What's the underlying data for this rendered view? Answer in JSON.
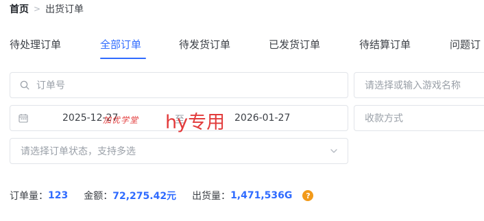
{
  "breadcrumb": {
    "home": "首页",
    "separator": ">",
    "current": "出货订单"
  },
  "tabs": [
    {
      "label": "待处理订单",
      "active": false
    },
    {
      "label": "全部订单",
      "active": true
    },
    {
      "label": "待发货订单",
      "active": false
    },
    {
      "label": "已发货订单",
      "active": false
    },
    {
      "label": "待结算订单",
      "active": false
    },
    {
      "label": "问题订",
      "active": false
    }
  ],
  "filters": {
    "order_no_placeholder": "订单号",
    "game_placeholder": "请选择或输入游戏名称",
    "date_start": "2025-12-27",
    "date_separator": "至",
    "date_end": "2026-01-27",
    "payment_placeholder": "收款方式",
    "status_placeholder": "请选择订单状态，支持多选",
    "watermark_overlay": "hy专用",
    "stamp_text": "加优学堂"
  },
  "summary": {
    "order_count_label": "订单量：",
    "order_count": "123",
    "amount_label": "金额：",
    "amount": "72,275.42元",
    "shipped_label": "出货量：",
    "shipped": "1,471,536G",
    "help_icon": "?"
  },
  "colors": {
    "accent": "#2f6bff",
    "help": "#f29a1a",
    "overlay": "#e23a3a"
  }
}
